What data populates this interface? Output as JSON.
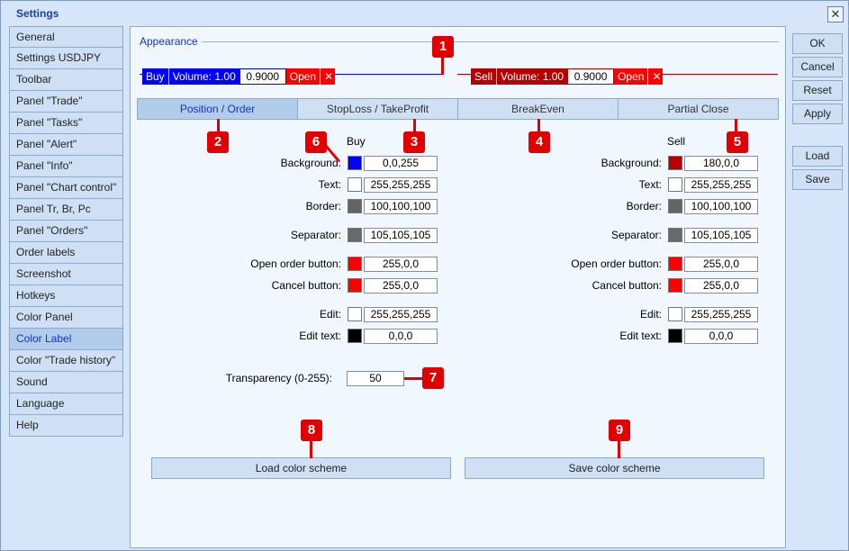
{
  "window": {
    "title": "Settings",
    "close_glyph": "✕"
  },
  "sidebar": {
    "items": [
      "General",
      "Settings USDJPY",
      "Toolbar",
      "Panel \"Trade\"",
      "Panel \"Tasks\"",
      "Panel \"Alert\"",
      "Panel \"Info\"",
      "Panel \"Chart control\"",
      "Panel Tr, Br, Pc",
      "Panel \"Orders\"",
      "Order labels",
      "Screenshot",
      "Hotkeys",
      "Color Panel",
      "Color Label",
      "Color \"Trade history\"",
      "Sound",
      "Language",
      "Help"
    ],
    "active_index": 14
  },
  "right_buttons": {
    "ok": "OK",
    "cancel": "Cancel",
    "reset": "Reset",
    "apply": "Apply",
    "load": "Load",
    "save": "Save"
  },
  "appearance": {
    "label": "Appearance",
    "buy_label": {
      "side": "Buy",
      "volume": "Volume: 1.00",
      "price": "0.9000",
      "open": "Open",
      "close": "✕",
      "color": "#0000ff"
    },
    "sell_label": {
      "side": "Sell",
      "volume": "Volume: 1.00",
      "price": "0.9000",
      "open": "Open",
      "close": "✕",
      "color": "#b40000"
    }
  },
  "tabs": [
    "Position / Order",
    "StopLoss / TakeProfit",
    "BreakEven",
    "Partial Close"
  ],
  "active_tab": 0,
  "columns": {
    "buy": "Buy",
    "sell": "Sell"
  },
  "rows": [
    {
      "label": "Background:",
      "buy": "0,0,255",
      "buy_color": "#0000ff",
      "sell": "180,0,0",
      "sell_color": "#b40000"
    },
    {
      "label": "Text:",
      "buy": "255,255,255",
      "buy_color": "#ffffff",
      "sell": "255,255,255",
      "sell_color": "#ffffff"
    },
    {
      "label": "Border:",
      "buy": "100,100,100",
      "buy_color": "#646464",
      "sell": "100,100,100",
      "sell_color": "#646464"
    },
    {
      "label": "Separator:",
      "buy": "105,105,105",
      "buy_color": "#696969",
      "sell": "105,105,105",
      "sell_color": "#696969"
    },
    {
      "label": "Open order button:",
      "buy": "255,0,0",
      "buy_color": "#ff0000",
      "sell": "255,0,0",
      "sell_color": "#ff0000"
    },
    {
      "label": "Cancel button:",
      "buy": "255,0,0",
      "buy_color": "#ff0000",
      "sell": "255,0,0",
      "sell_color": "#ff0000"
    },
    {
      "label": "Edit:",
      "buy": "255,255,255",
      "buy_color": "#ffffff",
      "sell": "255,255,255",
      "sell_color": "#ffffff"
    },
    {
      "label": "Edit text:",
      "buy": "0,0,0",
      "buy_color": "#000000",
      "sell": "0,0,0",
      "sell_color": "#000000"
    }
  ],
  "transparency": {
    "label": "Transparency (0-255):",
    "value": "50"
  },
  "scheme_buttons": {
    "load": "Load color scheme",
    "save": "Save color scheme"
  },
  "markers": [
    "1",
    "2",
    "3",
    "4",
    "5",
    "6",
    "7",
    "8",
    "9"
  ],
  "colors": {
    "accent": "#1033c8",
    "marker": "#e00000"
  }
}
